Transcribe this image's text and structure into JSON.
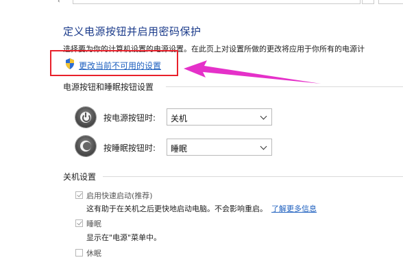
{
  "page": {
    "title": "定义电源按钮并启用密码保护",
    "description": "选择要为你的计算机设置的电源设置。在此页上对设置所做的更改将应用于你所有的电源计",
    "change_link": "更改当前不可用的设置"
  },
  "power_buttons_section": {
    "heading": "电源按钮和睡眠按钮设置",
    "power_button": {
      "label": "按电源按钮时:",
      "value": "关机"
    },
    "sleep_button": {
      "label": "按睡眠按钮时:",
      "value": "睡眠"
    }
  },
  "shutdown_section": {
    "heading": "关机设置",
    "fast_startup": {
      "label": "启用快速启动(推荐)",
      "checked": true,
      "description": "这有助于在关机之后更快地启动电脑。不会影响重启。",
      "more_link": "了解更多信息"
    },
    "sleep": {
      "label": "睡眠",
      "checked": true,
      "description": "显示在\"电源\"菜单中。"
    },
    "hibernate": {
      "label": "休眠",
      "checked": false
    }
  },
  "annotation_colors": {
    "box": "#e8202a",
    "arrow": "#e531c9"
  },
  "icons": [
    "back-arrow-icon",
    "address-icon",
    "shield-icon",
    "power-icon",
    "sleep-icon",
    "chevron-down-icon",
    "checkbox-icon"
  ]
}
